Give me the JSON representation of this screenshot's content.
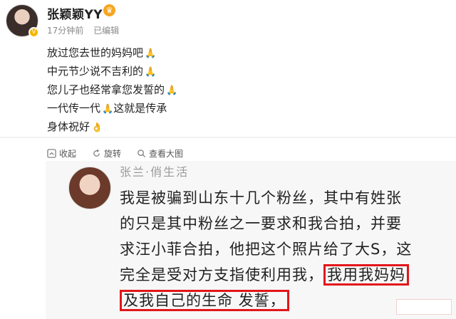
{
  "post": {
    "username": "张颖颖YY",
    "time": "17分钟前",
    "edited": "已编辑",
    "lines": [
      {
        "text": "放过您去世的妈妈吧",
        "emoji": "🙏"
      },
      {
        "text": "中元节少说不吉利的",
        "emoji": "🙏"
      },
      {
        "text": "您儿子也经常拿您发誓的",
        "emoji": "🙏"
      },
      {
        "text": "一代传一代",
        "emoji": "🙏",
        "after": "这就是传承"
      },
      {
        "text": "身体祝好",
        "emoji": "👌"
      }
    ],
    "avatar_badge_icon": "verified-v-icon",
    "vip_icon": "crown-icon"
  },
  "actions": {
    "collapse": "收起",
    "rotate": "旋转",
    "view_large": "查看大图"
  },
  "image": {
    "name": "张兰·俏生活",
    "lines": [
      "我是被骗到山东十几个粉丝，其中有姓张",
      "的只是其中粉丝之一要求和我合拍，并要",
      "求汪小菲合拍，他把这个照片给了大S，这",
      "完全是受对方支指使利用我，"
    ],
    "hl1": "我用我妈妈",
    "hl2": "及我自己的生命 发誓，",
    "highlight_color": "#e3151a"
  }
}
